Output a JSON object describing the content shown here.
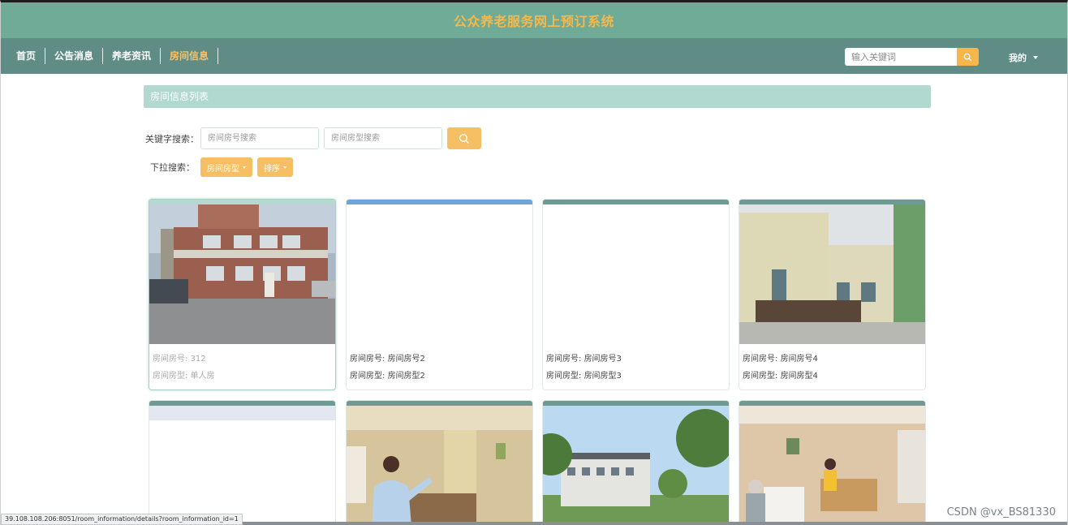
{
  "site": {
    "title": "公众养老服务网上预订系统"
  },
  "nav": {
    "items": [
      {
        "label": "首页",
        "active": false
      },
      {
        "label": "公告消息",
        "active": false
      },
      {
        "label": "养老资讯",
        "active": false
      },
      {
        "label": "房间信息",
        "active": true
      }
    ],
    "search_placeholder": "输入关键词",
    "search_icon": "search-icon",
    "user_menu": "我的"
  },
  "page": {
    "list_title": "房间信息列表",
    "keyword_label": "关键字搜索：",
    "room_no_placeholder": "房间房号搜索",
    "room_type_placeholder": "房间房型搜索",
    "dropdown_label": "下拉搜索：",
    "dropdowns": [
      "房间房型",
      "排序"
    ]
  },
  "cards": [
    {
      "no_label": "房间房号:",
      "no": "312",
      "type_label": "房间房型:",
      "type": "单人房",
      "image": "brick-building-photo"
    },
    {
      "no_label": "房间房号:",
      "no": "房间房号2",
      "type_label": "房间房型:",
      "type": "房间房型2",
      "image": "blank"
    },
    {
      "no_label": "房间房号:",
      "no": "房间房号3",
      "type_label": "房间房型:",
      "type": "房间房型3",
      "image": "blank"
    },
    {
      "no_label": "房间房号:",
      "no": "房间房号4",
      "type_label": "房间房型:",
      "type": "房间房型4",
      "image": "courtyard-photo"
    },
    {
      "image": "blank"
    },
    {
      "image": "room-with-woman-photo"
    },
    {
      "image": "garden-building-photo"
    },
    {
      "image": "elderly-bedroom-photo"
    }
  ],
  "statusbar": {
    "url": "39.108.108.206:8051/room_information/details?room_information_id=1"
  },
  "watermark": "CSDN @vx_BS81330",
  "colors": {
    "header": "#6fab96",
    "nav": "#5f8d86",
    "accent": "#f6bf63",
    "title": "#f5b84a",
    "list_head": "#b2d9cf"
  }
}
